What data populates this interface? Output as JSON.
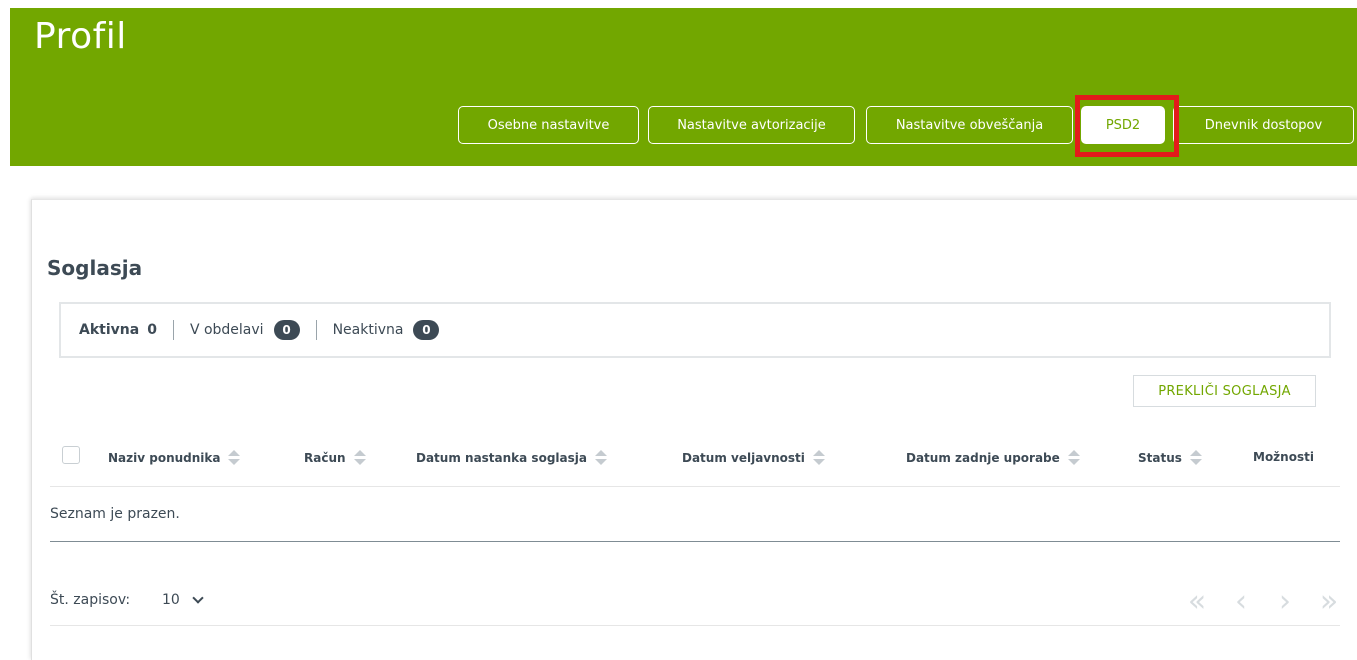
{
  "header": {
    "title": "Profil",
    "tabs": [
      {
        "label": "Osebne nastavitve"
      },
      {
        "label": "Nastavitve avtorizacije"
      },
      {
        "label": "Nastavitve obveščanja"
      },
      {
        "label": "PSD2",
        "active": true
      },
      {
        "label": "Dnevnik dostopov"
      }
    ]
  },
  "section": {
    "title": "Soglasja",
    "filters": [
      {
        "label": "Aktivna",
        "count": "0",
        "active": true
      },
      {
        "label": "V obdelavi",
        "count": "0"
      },
      {
        "label": "Neaktivna",
        "count": "0"
      }
    ],
    "revoke_label": "PREKLIČI SOGLASJA"
  },
  "table": {
    "columns": [
      "Naziv ponudnika",
      "Račun",
      "Datum nastanka soglasja",
      "Datum veljavnosti",
      "Datum zadnje uporabe",
      "Status",
      "Možnosti"
    ],
    "empty_text": "Seznam je prazen."
  },
  "footer": {
    "records_label": "Št. zapisov:",
    "records_value": "10",
    "pager": [
      "«",
      "‹",
      "›",
      "»"
    ]
  },
  "colors": {
    "brand_green": "#72a700",
    "highlight_red": "#e31b1b",
    "dark_text": "#3d4a55"
  }
}
